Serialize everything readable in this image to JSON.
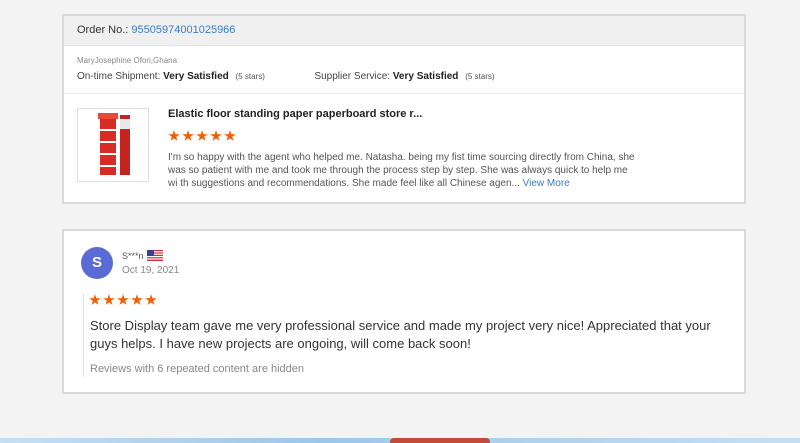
{
  "order": {
    "label": "Order No.:",
    "number": "95505974001025966"
  },
  "reviewer": {
    "name_location": "MaryJosephine Ofori,Ghana"
  },
  "ratings": {
    "shipment_label": "On-time Shipment:",
    "shipment_value": "Very Satisfied",
    "shipment_stars": "(5 stars)",
    "supplier_label": "Supplier Service:",
    "supplier_value": "Very Satisfied",
    "supplier_stars": "(5 stars)"
  },
  "product": {
    "title": "Elastic floor standing paper paperboard store r...",
    "rating": 5,
    "review_text": "I'm so happy with the agent who helped me. Natasha. being my fist time sourcing directly from China, she was so patient with me and took me through the process step by step. She was always quick to help me wi th suggestions and recommendations. She made feel like all Chinese agen...",
    "view_more": "View More"
  },
  "review2": {
    "avatar_letter": "S",
    "user": "S***n",
    "flag": "us-flag-icon",
    "date": "Oct 19, 2021",
    "rating": 5,
    "text": "Store Display team gave me very professional service and made my project very nice! Appreciated that your guys helps. I have new projects are ongoing, will come back soon!",
    "hidden_note": "Reviews with 6 repeated content are hidden"
  },
  "colors": {
    "star": "#f25c05",
    "link": "#3a7bc8",
    "avatar": "#5a6bd6"
  }
}
